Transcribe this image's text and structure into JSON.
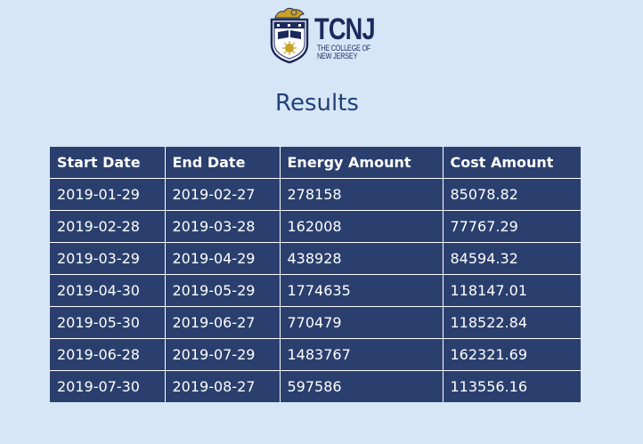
{
  "logo": {
    "icon": "tcnj-crest-icon",
    "wordmark": "TCNJ",
    "line1": "THE COLLEGE OF",
    "line2": "NEW JERSEY"
  },
  "page": {
    "title": "Results"
  },
  "table": {
    "headers": [
      "Start Date",
      "End Date",
      "Energy Amount",
      "Cost Amount"
    ],
    "rows": [
      [
        "2019-01-29",
        "2019-02-27",
        "278158",
        "85078.82"
      ],
      [
        "2019-02-28",
        "2019-03-28",
        "162008",
        "77767.29"
      ],
      [
        "2019-03-29",
        "2019-04-29",
        "438928",
        "84594.32"
      ],
      [
        "2019-04-30",
        "2019-05-29",
        "1774635",
        "118147.01"
      ],
      [
        "2019-05-30",
        "2019-06-27",
        "770479",
        "118522.84"
      ],
      [
        "2019-06-28",
        "2019-07-29",
        "1483767",
        "162321.69"
      ],
      [
        "2019-07-30",
        "2019-08-27",
        "597586",
        "113556.16"
      ]
    ]
  },
  "colors": {
    "background": "#d6e6f6",
    "table_fill": "#2a3f6d",
    "title": "#23407a",
    "brand": "#1b2a5c"
  }
}
